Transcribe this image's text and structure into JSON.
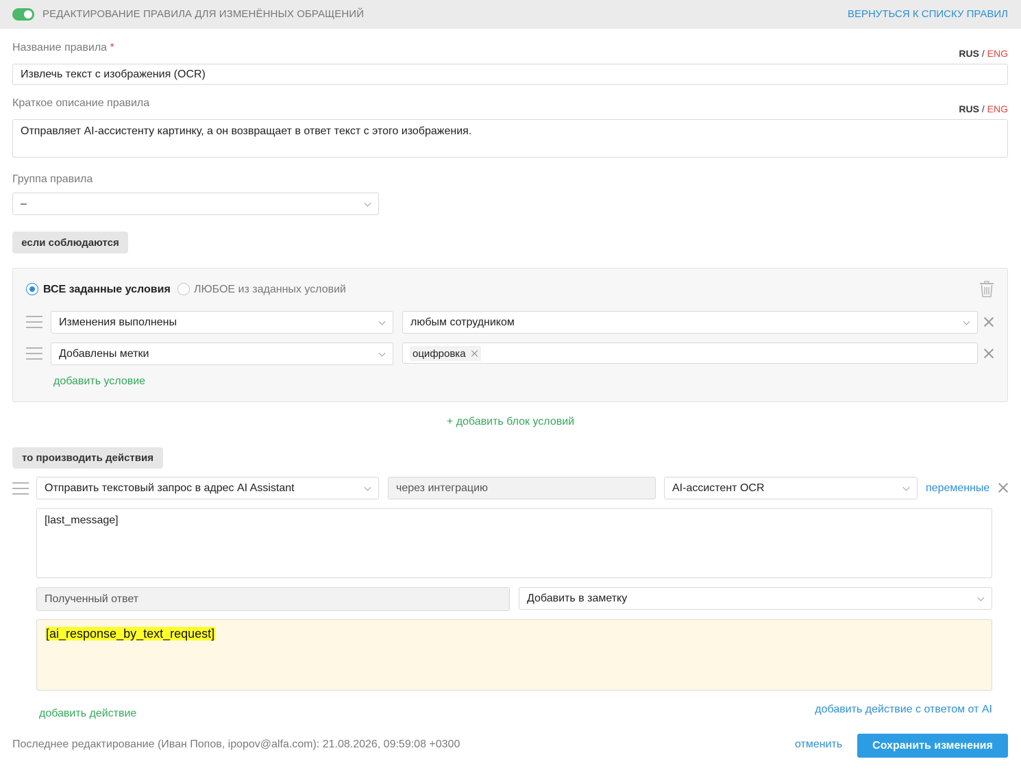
{
  "header": {
    "title": "РЕДАКТИРОВАНИЕ ПРАВИЛА ДЛЯ ИЗМЕНЁННЫХ ОБРАЩЕНИЙ",
    "back_link": "ВЕРНУТЬСЯ К СПИСКУ ПРАВИЛ",
    "enabled": true
  },
  "lang_switch": {
    "rus": "RUS",
    "separator": "/",
    "eng": "ENG"
  },
  "rule_name": {
    "label": "Название правила",
    "required_mark": "*",
    "value": "Извлечь текст с изображения (OCR)"
  },
  "rule_description": {
    "label": "Краткое описание правила",
    "value": "Отправляет AI-ассистенту картинку, а он возвращает в ответ текст с этого изображения."
  },
  "rule_group": {
    "label": "Группа правила",
    "value": "–"
  },
  "conditions": {
    "section_label": "если соблюдаются",
    "mode_all": "ВСЕ заданные условия",
    "mode_any": "ЛЮБОЕ из заданных условий",
    "selected_mode": "all",
    "rows": [
      {
        "field": "Изменения выполнены",
        "value": "любым сотрудником"
      },
      {
        "field": "Добавлены метки",
        "tags": [
          "оцифровка"
        ]
      }
    ],
    "add_condition": "добавить условие",
    "add_block": "+ добавить блок условий"
  },
  "actions": {
    "section_label": "то производить действия",
    "action_type": "Отправить текстовый запрос в адрес AI Assistant",
    "via": "через интеграцию",
    "assistant": "AI-ассистент OCR",
    "variables_link": "переменные",
    "request_text": "[last_message]",
    "response_label": "Полученный ответ",
    "response_target": "Добавить в заметку",
    "response_text": "[ai_response_by_text_request]",
    "add_action": "добавить действие",
    "add_ai_action": "добавить действие с ответом от AI"
  },
  "footer": {
    "last_edit": "Последнее редактирование (Иван Попов, ipopov@alfa.com): 21.08.2026, 09:59:08 +0300",
    "cancel": "отменить",
    "save": "Сохранить изменения"
  },
  "colors": {
    "accent_blue": "#2d8fd6",
    "accent_green": "#33a85a",
    "required_red": "#e0453a",
    "highlight_yellow": "#ffff2a",
    "response_bg": "#fff8e5"
  }
}
